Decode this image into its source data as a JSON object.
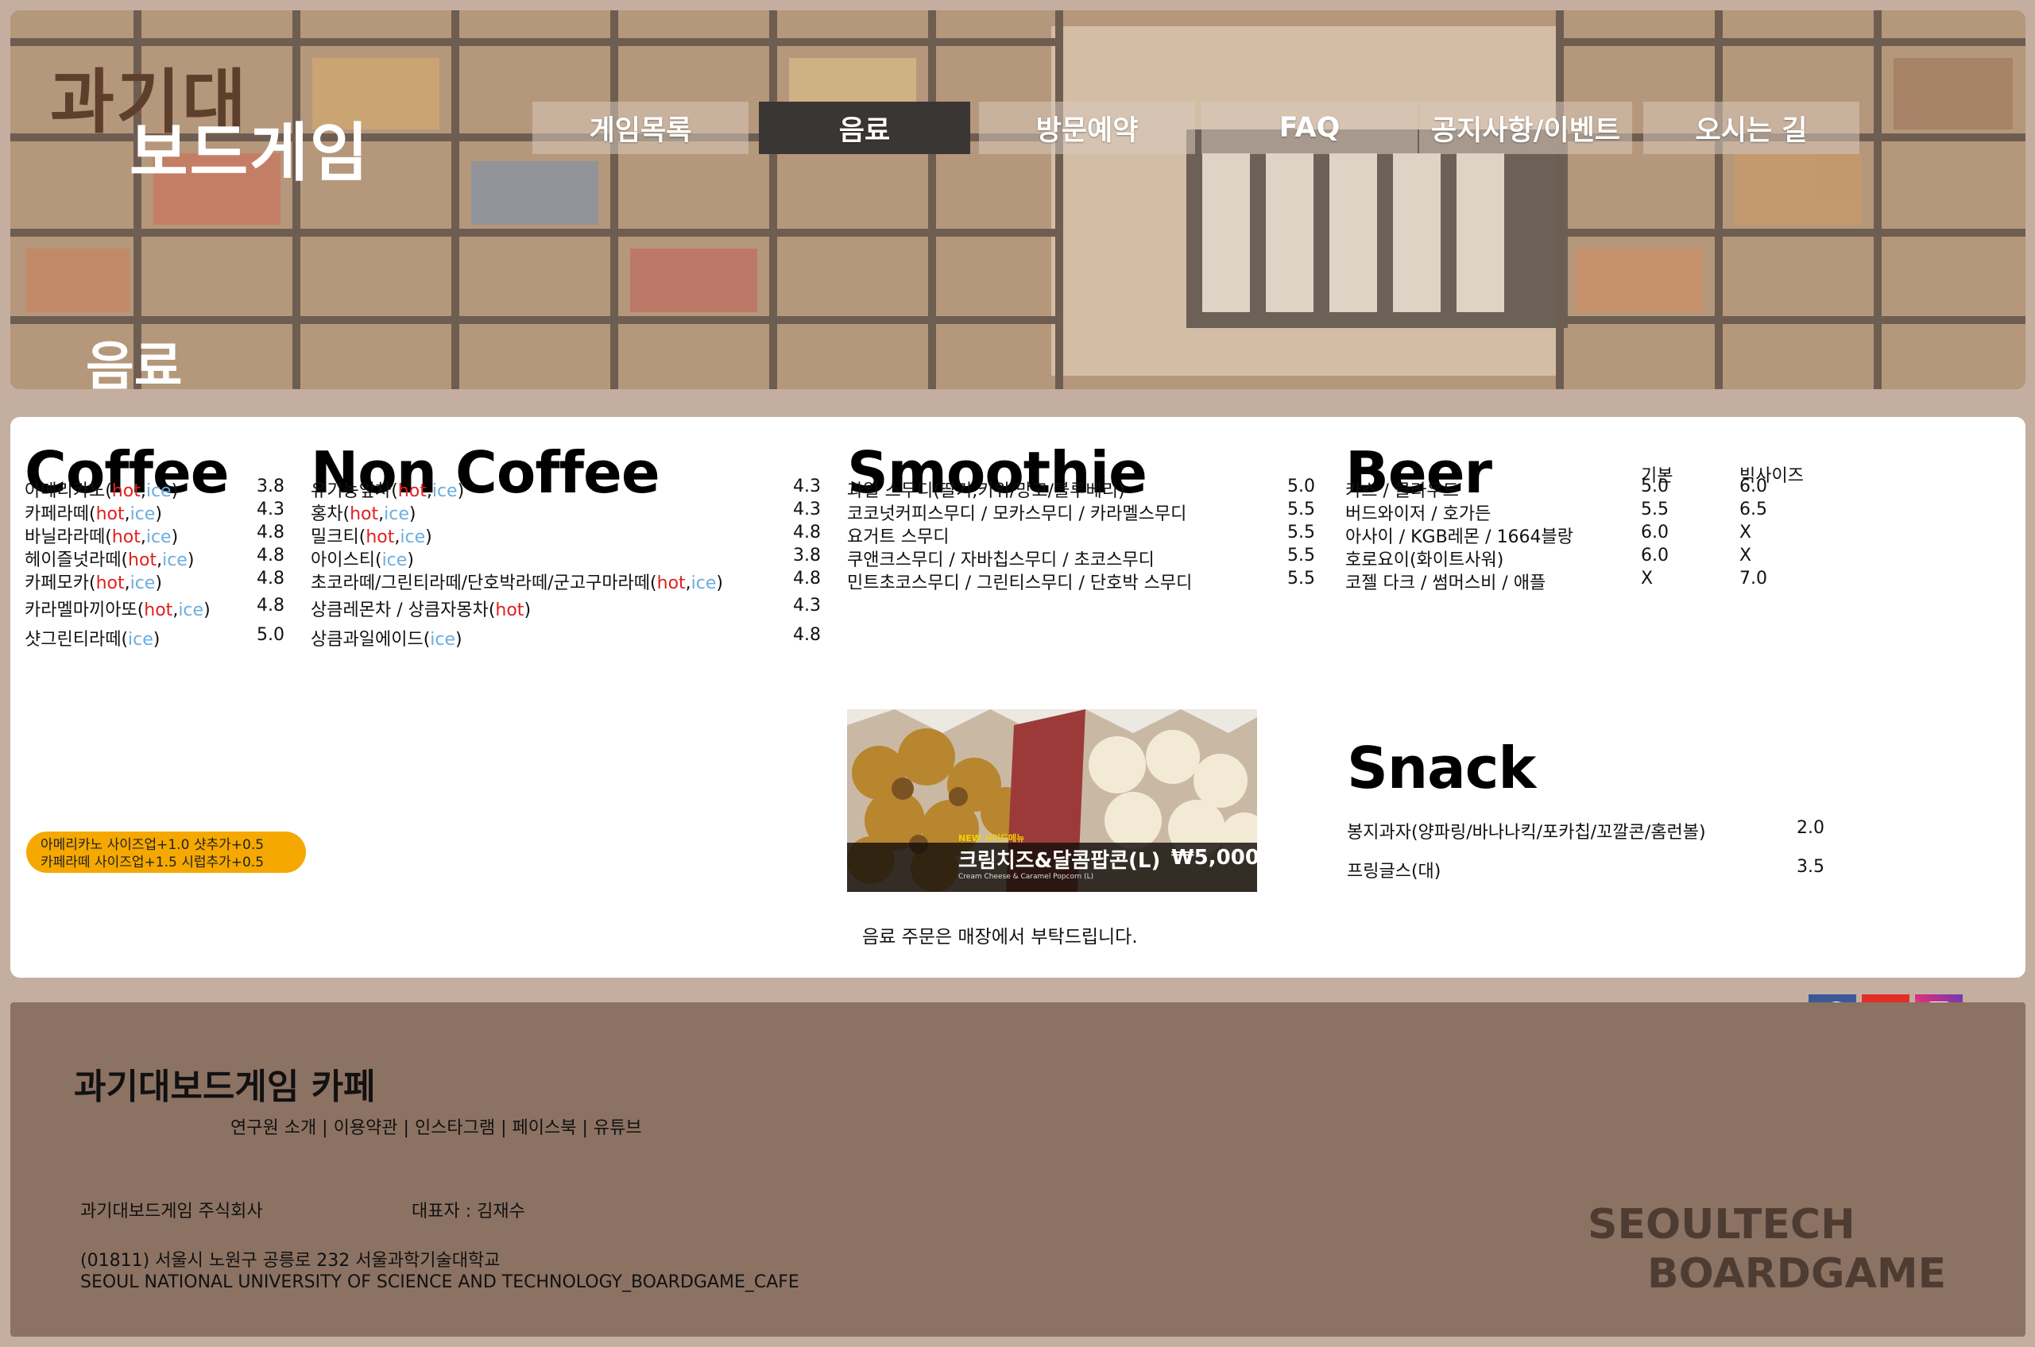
{
  "header": {
    "logo_line1": "과기대",
    "logo_line2": "보드게임",
    "nav": [
      "게임목록",
      "음료",
      "방문예약",
      "FAQ",
      "공지사항/이벤트",
      "오시는 길"
    ],
    "page_title": "음료"
  },
  "coffee": {
    "title": "Coffee",
    "items": [
      {
        "name": "아메리카노",
        "hot": "hot",
        "ice": "ice",
        "price": "3.8"
      },
      {
        "name": "카페라떼",
        "hot": "hot",
        "ice": "ice",
        "price": "4.3"
      },
      {
        "name": "바닐라라떼",
        "hot": "hot",
        "ice": "ice",
        "price": "4.8"
      },
      {
        "name": "헤이즐넛라떼",
        "hot": "hot",
        "ice": "ice",
        "price": "4.8"
      },
      {
        "name": "카페모카",
        "hot": "hot",
        "ice": "ice",
        "price": "4.8"
      },
      {
        "name": "카라멜마끼아또",
        "hot": "hot",
        "ice": "ice",
        "price": "4.8"
      },
      {
        "name": "샷그린티라떼",
        "hot": "",
        "ice": "ice",
        "price": "5.0"
      }
    ],
    "note_line1": "아메리카노 사이즈업+1.0 샷추가+0.5",
    "note_line2": "카페라떼 사이즈업+1.5 시럽추가+0.5"
  },
  "noncoffee": {
    "title": "Non Coffee",
    "items": [
      {
        "name": "유기농잎차",
        "hot": "hot",
        "ice": "ice",
        "price": "4.3"
      },
      {
        "name": "홍차",
        "hot": "hot",
        "ice": "ice",
        "price": "4.3"
      },
      {
        "name": "밀크티",
        "hot": "hot",
        "ice": "ice",
        "price": "4.8"
      },
      {
        "name": "아이스티",
        "hot": "",
        "ice": "ice",
        "price": "3.8"
      },
      {
        "name": "초코라떼/그린티라떼/단호박라떼/군고구마라떼",
        "hot": "hot",
        "ice": "ice",
        "price": "4.8"
      },
      {
        "name": "상큼레몬차 / 상큼자몽차",
        "hot": "hot",
        "ice": "",
        "price": "4.3"
      },
      {
        "name": "상큼과일에이드",
        "hot": "",
        "ice": "ice",
        "price": "4.8"
      }
    ]
  },
  "smoothie": {
    "title": "Smoothie",
    "items": [
      {
        "name": "과일 스무디(딸기,키위/망고/블루베리)",
        "price": "5.0"
      },
      {
        "name": "코코넛커피스무디 / 모카스무디 / 카라멜스무디",
        "price": "5.5"
      },
      {
        "name": "요거트 스무디",
        "price": "5.5"
      },
      {
        "name": "쿠앤크스무디 / 자바칩스무디 / 초코스무디",
        "price": "5.5"
      },
      {
        "name": "민트초코스무디 / 그린티스무디 / 단호박 스무디",
        "price": "5.5"
      }
    ],
    "promo_badge": "NEW 사이드메뉴",
    "promo_name": "크림치즈&달콤팝콘(L)",
    "promo_price": "₩5,000",
    "promo_sub": "Cream Cheese & Caramel Popcorn (L)",
    "order_note": "음료 주문은 매장에서 부탁드립니다."
  },
  "beer": {
    "title": "Beer",
    "col_regular": "기본",
    "col_big": "빅사이즈",
    "items": [
      {
        "name": "카스 / 클라우드",
        "regular": "5.0",
        "big": "6.0"
      },
      {
        "name": "버드와이저 / 호가든",
        "regular": "5.5",
        "big": "6.5"
      },
      {
        "name": "아사이 / KGB레몬 / 1664블랑",
        "regular": "6.0",
        "big": "X"
      },
      {
        "name": "호로요이(화이트사워)",
        "regular": "6.0",
        "big": "X"
      },
      {
        "name": "코젤 다크 / 썸머스비 / 애플",
        "regular": "X",
        "big": "7.0"
      }
    ]
  },
  "snack": {
    "title": "Snack",
    "items": [
      {
        "name": "봉지과자(양파링/바나나킥/포카칩/꼬깔콘/홈런볼)",
        "price": "2.0"
      },
      {
        "name": "프링글스(대)",
        "price": "3.5"
      }
    ]
  },
  "footer": {
    "company": "과기대보드게임 카페",
    "links": "연구원 소개 | 이용약관 | 인스타그램 | 페이스북 | 유튜브",
    "corp": "과기대보드게임 주식회사",
    "ceo": "대표자 : 김재수",
    "address": "(01811) 서울시 노원구 공릉로 232 서울과학기술대학교",
    "address_en": "SEOUL NATIONAL UNIVERSITY OF SCIENCE AND TECHNOLOGY_BOARDGAME_CAFE",
    "brand1": "SEOULTECH",
    "brand2": "BOARDGAME"
  },
  "social": [
    "facebook-icon",
    "youtube-icon",
    "instagram-icon"
  ],
  "colors": {
    "hot": "#e02020",
    "ice": "#6aaee0",
    "note_bg": "#f5a800",
    "footer_bg": "#8c7263",
    "page_bg": "#c4ae9f"
  }
}
